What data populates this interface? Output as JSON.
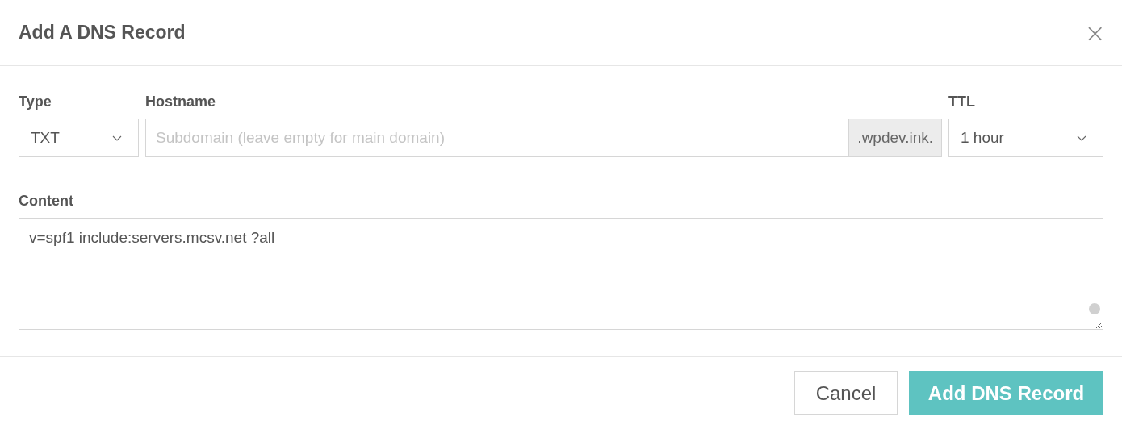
{
  "dialog": {
    "title": "Add A DNS Record",
    "close": "×"
  },
  "fields": {
    "type": {
      "label": "Type",
      "value": "TXT"
    },
    "hostname": {
      "label": "Hostname",
      "placeholder": "Subdomain (leave empty for main domain)",
      "suffix": ".wpdev.ink."
    },
    "ttl": {
      "label": "TTL",
      "value": "1 hour"
    },
    "content": {
      "label": "Content",
      "value": "v=spf1 include:servers.mcsv.net ?all"
    }
  },
  "buttons": [
    {
      "label": "Cancel",
      "kind": "secondary"
    },
    {
      "label": "Add DNS Record",
      "kind": "primary"
    }
  ]
}
